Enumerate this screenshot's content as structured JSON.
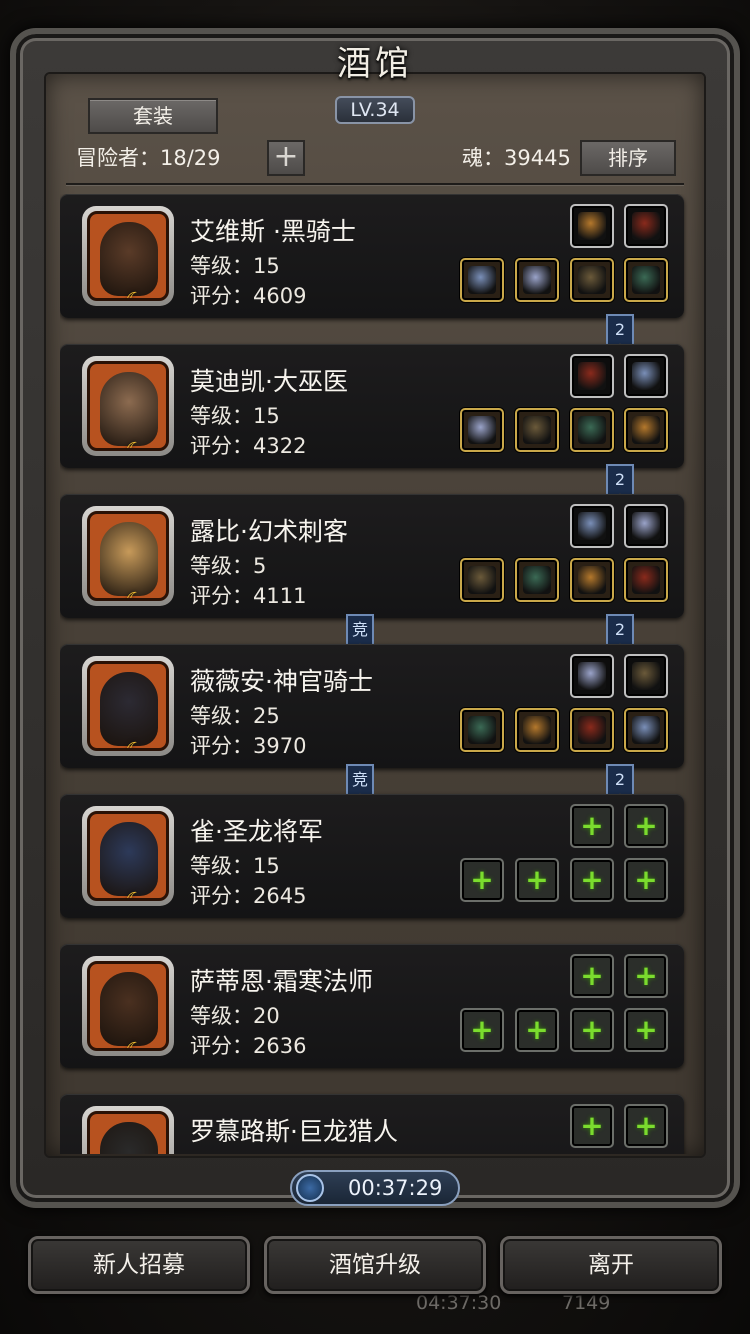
{
  "header": {
    "title": "酒馆",
    "level": "LV.34",
    "set_button": "套装",
    "adventurers": "冒险者：18/29",
    "plus_button": "+",
    "soul": "魂：39445",
    "sort_button": "排序"
  },
  "heroes": [
    {
      "name": "艾维斯 ·黑骑士",
      "level": "等级：15",
      "score": "评分：4609",
      "portrait_color": "#5a3b28",
      "slots": [
        "acc",
        "acc",
        "equip",
        "equip",
        "equip",
        "equip"
      ],
      "tag_right": "2",
      "tag_left": ""
    },
    {
      "name": "莫迪凯·大巫医",
      "level": "等级：15",
      "score": "评分：4322",
      "portrait_color": "#8c6b50",
      "slots": [
        "acc",
        "acc",
        "equip",
        "equip",
        "equip",
        "equip"
      ],
      "tag_right": "2",
      "tag_left": ""
    },
    {
      "name": "露比·幻术刺客",
      "level": "等级：5",
      "score": "评分：4111",
      "portrait_color": "#c79a5a",
      "slots": [
        "acc",
        "acc",
        "equip",
        "equip",
        "equip",
        "equip"
      ],
      "tag_right": "2",
      "tag_left": "竞"
    },
    {
      "name": "薇薇安·神官骑士",
      "level": "等级：25",
      "score": "评分：3970",
      "portrait_color": "#2c2a33",
      "slots": [
        "acc",
        "acc",
        "equip",
        "equip",
        "equip",
        "equip"
      ],
      "tag_right": "2",
      "tag_left": "竞"
    },
    {
      "name": "雀·圣龙将军",
      "level": "等级：15",
      "score": "评分：2645",
      "portrait_color": "#2d3a5a",
      "slots": [
        "empty",
        "empty",
        "empty",
        "empty",
        "empty",
        "empty"
      ],
      "tag_right": "",
      "tag_left": ""
    },
    {
      "name": "萨蒂恩·霜寒法师",
      "level": "等级：20",
      "score": "评分：2636",
      "portrait_color": "#4a3020",
      "slots": [
        "empty",
        "empty",
        "empty",
        "empty",
        "empty",
        "empty"
      ],
      "tag_right": "",
      "tag_left": ""
    },
    {
      "name": "罗慕路斯·巨龙猎人",
      "level": "",
      "score": "",
      "portrait_color": "#2a2a2a",
      "slots": [
        "empty",
        "empty"
      ],
      "tag_right": "",
      "tag_left": ""
    }
  ],
  "timer": "00:37:29",
  "buttons": {
    "recruit": "新人招募",
    "upgrade": "酒馆升级",
    "leave": "离开"
  },
  "under_layer": {
    "clock": "04:37:30",
    "gems": "7149"
  },
  "colors": {
    "equip_border": "#c9a84a",
    "plus_green": "#7bdc2e",
    "tag_blue": "#1a2c4a"
  }
}
